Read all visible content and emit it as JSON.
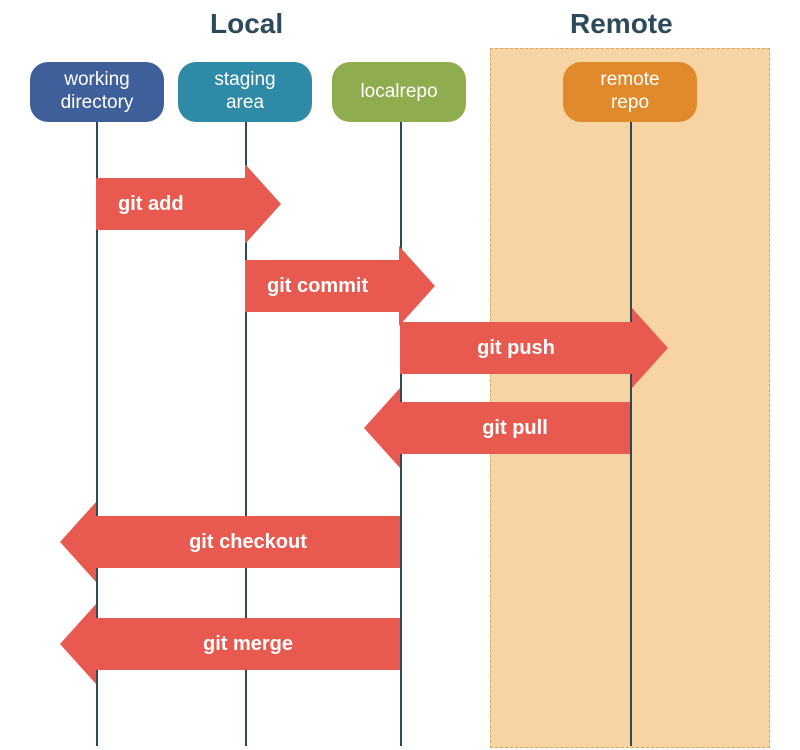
{
  "sections": {
    "local": "Local",
    "remote": "Remote"
  },
  "columns": {
    "working_directory": {
      "line1": "working",
      "line2": "directory"
    },
    "staging_area": {
      "line1": "staging",
      "line2": "area"
    },
    "local_repo": {
      "line1": "localrepo"
    },
    "remote_repo": {
      "line1": "remote",
      "line2": "repo"
    }
  },
  "arrows": {
    "add": "git add",
    "commit": "git commit",
    "push": "git push",
    "pull": "git pull",
    "checkout": "git checkout",
    "merge": "git merge"
  },
  "colors": {
    "working_directory": "#3f5f9a",
    "staging_area": "#2f8aa8",
    "local_repo": "#8fad4f",
    "remote_repo": "#e08a2c",
    "arrow": "#e85a4f",
    "remote_bg": "#f7d4a3"
  }
}
